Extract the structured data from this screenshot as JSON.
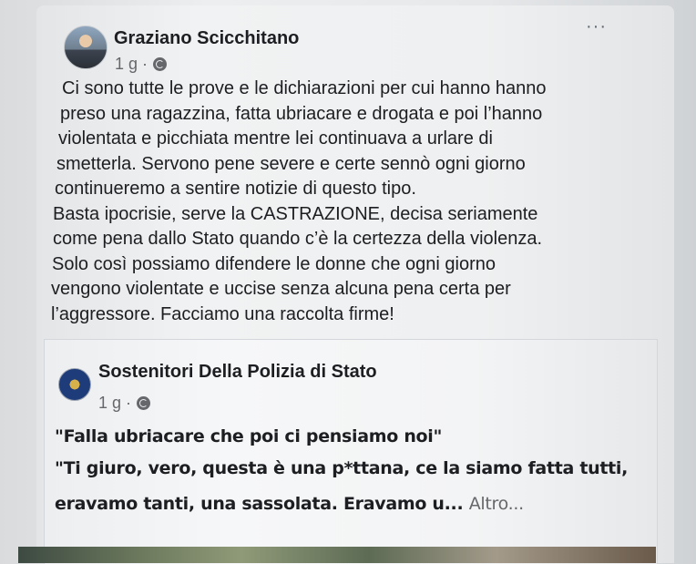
{
  "post": {
    "author": "Graziano Scicchitano",
    "time": "1 g ·",
    "more_label": "···",
    "privacy_icon": "globe-icon",
    "lines": [
      "Ci sono tutte le prove e le dichiarazioni per cui hanno hanno",
      "preso una ragazzina, fatta ubriacare e drogata e poi l’hanno",
      "violentata e picchiata mentre lei continuava a urlare di",
      "smetterla. Servono pene severe e certe sennò ogni giorno",
      "continueremo a sentire notizie di questo tipo.",
      "Basta ipocrisie, serve la CASTRAZIONE, decisa seriamente",
      "come pena dallo Stato quando c’è la certezza della violenza.",
      "Solo così possiamo difendere le donne che ogni giorno",
      "vengono violentate e uccise senza alcuna pena certa per",
      "l’aggressore. Facciamo una raccolta firme!"
    ]
  },
  "shared_post": {
    "author": "Sostenitori Della Polizia di Stato",
    "time": "1 g ·",
    "privacy_icon": "globe-icon",
    "quote_1": "\"Falla ubriacare che poi ci pensiamo noi\"",
    "quote_2": "\"Ti giuro, vero, questa è una p*ttana, ce la siamo fatta tutti,",
    "quote_3": "eravamo tanti, una sassolata. Eravamo u...",
    "see_more": "Altro..."
  },
  "colors": {
    "text": "#1c1e21",
    "secondary": "#65676b"
  }
}
